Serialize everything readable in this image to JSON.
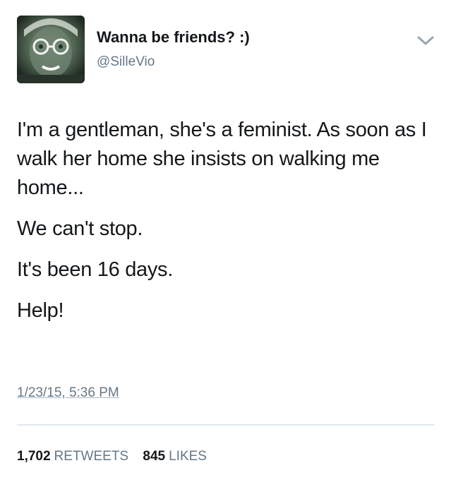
{
  "tweet": {
    "display_name": "Wanna be friends? :)",
    "handle": "@SilleVio",
    "avatar_icon": "profile-avatar-icon",
    "menu_icon": "chevron-down-icon",
    "text_lines": [
      "I'm a gentleman, she's a feminist. As soon as I walk her home she insists on walking me home...",
      "We can't stop.",
      "It's been 16 days.",
      "Help!"
    ],
    "timestamp": "1/23/15, 5:36 PM",
    "retweets": {
      "count": "1,702",
      "label": "RETWEETS"
    },
    "likes": {
      "count": "845",
      "label": "LIKES"
    }
  },
  "colors": {
    "text_primary": "#14171a",
    "text_secondary": "#657786",
    "divider": "#e1e8ed",
    "background": "#ffffff"
  }
}
